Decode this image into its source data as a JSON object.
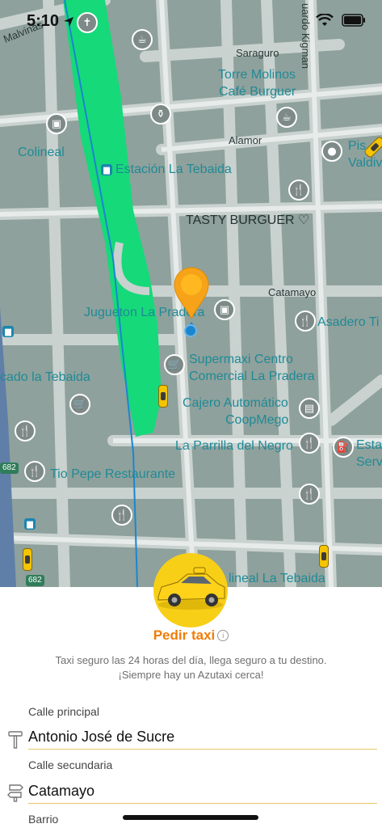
{
  "status_bar": {
    "time": "5:10"
  },
  "map": {
    "road_labels": {
      "saraguro": "Saraguro",
      "alamor": "Alamor",
      "catamayo": "Catamayo",
      "malvinas": "Malvinas",
      "kigman": "uardo Kigman"
    },
    "poi_labels": {
      "torre": "Torre Molinos",
      "cafe": "Café Burguer",
      "colineal": "Colineal",
      "estacion": "Estación La Tebaida",
      "tasty": "TASTY BURGUER ♡",
      "jugueton": "Jugueton La Pradera",
      "asadero": "Asadero Ti",
      "supermaxi1": "Supermaxi Centro",
      "supermaxi2": "Comercial La Pradera",
      "mercado": "cado la Tebaida",
      "cajero1": "Cajero Automático",
      "cajero2": "CoopMego",
      "parrilla": "La Parrilla del Negro",
      "esta": "Esta",
      "serv": "Serv",
      "tiopepe": "Tio Pepe Restaurante",
      "colineal2": "lineal La Tebaida",
      "pis": "Pis",
      "valdiv": "Valdiv"
    },
    "route_numbers": [
      "682",
      "682"
    ]
  },
  "panel": {
    "title": "Pedir taxi",
    "info": "i",
    "description_line1": "Taxi seguro las 24 horas del día, llega seguro a tu destino.",
    "description_line2": "¡Siempre hay un Azutaxi cerca!",
    "main_street_label": "Calle principal",
    "main_street_value": "Antonio José de Sucre",
    "secondary_street_label": "Calle secundaria",
    "secondary_street_value": "Catamayo",
    "neighborhood_label": "Barrio"
  },
  "colors": {
    "accent": "#f07d06",
    "taxi_yellow": "#f7cf16",
    "route_green": "#16d97a",
    "user_dot": "#1a86d0"
  }
}
